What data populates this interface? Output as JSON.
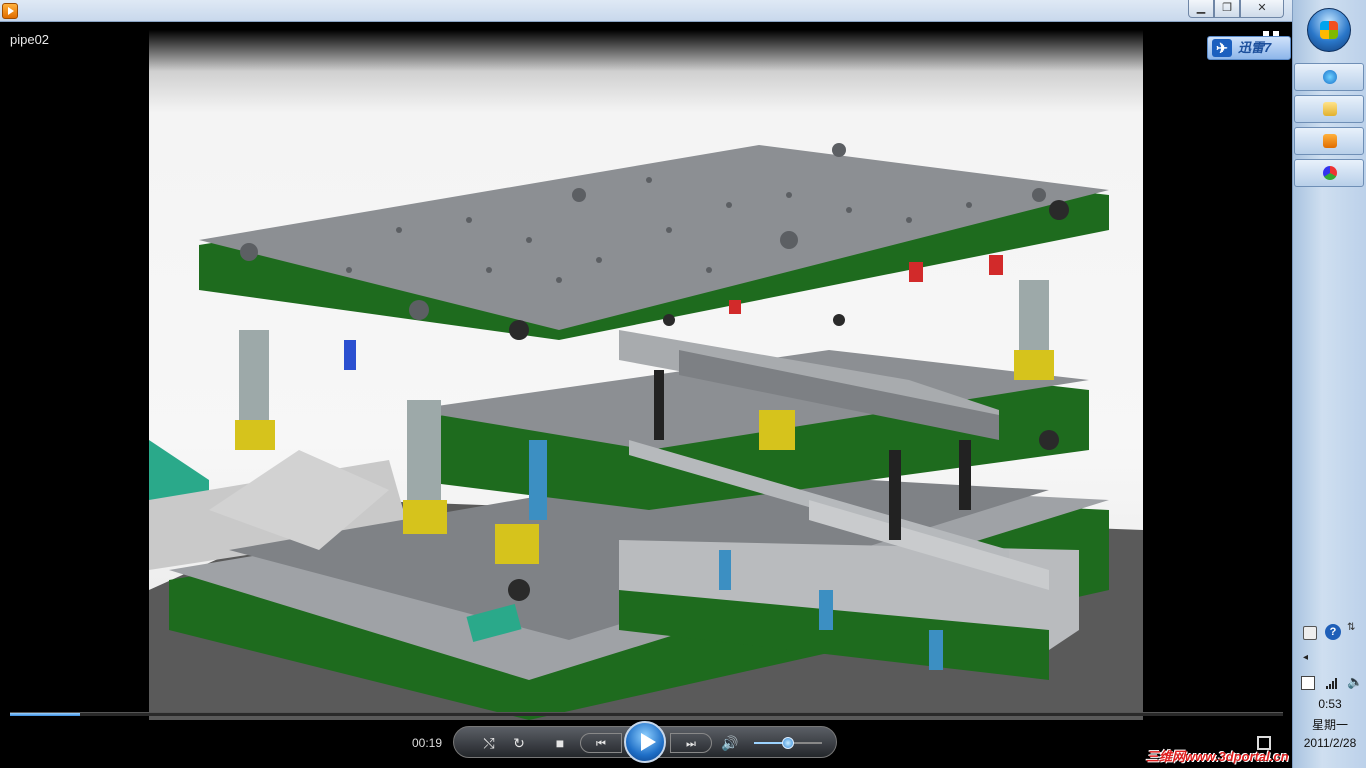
{
  "window": {
    "title": "pipe02",
    "minimize_symbol": "▁",
    "maximize_symbol": "❐",
    "close_symbol": "✕"
  },
  "player": {
    "elapsed": "00:19",
    "progress": 0.055,
    "volume": 0.48,
    "icons": {
      "shuffle": "⤭",
      "repeat": "↻",
      "stop": "■",
      "previous": "⏮",
      "next": "⏭",
      "mute": "🔊",
      "fullscreen": "switch-to-fullscreen-icon",
      "expand": "expand-icon"
    },
    "video": {
      "content": "3D CAD render of a progressive stamping die with green plates, grey die sets, springs and guide pillars"
    }
  },
  "overlay": {
    "xunlei_label": "迅雷7",
    "xunlei_icon_glyph": "✈"
  },
  "watermark": {
    "text": "三维网www.3dportal.cn"
  },
  "taskbar": {
    "buttons": [
      "internet-explorer",
      "windows-explorer",
      "media-player",
      "paint"
    ],
    "tray": {
      "help_glyph": "?",
      "restore_glyph": "⇅",
      "arrow_glyph": "◂",
      "speaker_glyph": "🔈"
    },
    "clock": {
      "time": "0:53",
      "day": "星期一",
      "date": "2011/2/28"
    }
  },
  "colors": {
    "plate_green": "#1e6b1e",
    "plate_grey": "#8c8f93",
    "accent_blue": "#2f86d8",
    "watermark_red": "#e02020"
  }
}
